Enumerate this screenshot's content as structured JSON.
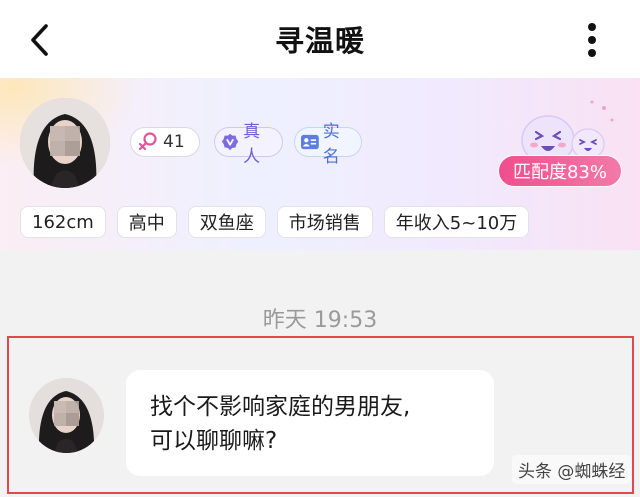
{
  "header": {
    "title": "寻温暖",
    "back_icon": "chevron-left-icon",
    "more_icon": "vertical-dots-icon"
  },
  "profile": {
    "likes_count": "41",
    "verified_label": "真人",
    "realname_label": "实名",
    "match_label": "匹配度83%",
    "tags": [
      "162cm",
      "高中",
      "双鱼座",
      "市场销售",
      "年收入5~10万"
    ]
  },
  "chat": {
    "timestamp": "昨天 19:53",
    "message_line1": "找个不影响家庭的男朋友,",
    "message_line2": "可以聊聊嘛?"
  },
  "watermark": "头条 @蜘蛛经",
  "colors": {
    "accent_pink": "#f04e8e",
    "highlight_red": "#e0474f",
    "verified_purple": "#6d5fd6",
    "realname_blue": "#4f6fd4"
  }
}
